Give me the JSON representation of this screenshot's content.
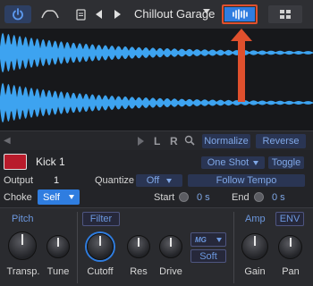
{
  "toolbar": {
    "preset_name": "Chillout Garage",
    "icons": [
      "power-icon",
      "envelope-icon",
      "preset-file-icon",
      "prev-arrow-icon",
      "next-arrow-icon",
      "waveform-view-icon",
      "pad-grid-icon"
    ]
  },
  "colors": {
    "accent": "#2f7de0",
    "highlight": "#e0502d",
    "pad": "#b81b2b",
    "waveform": "#3da3f0"
  },
  "wave_tools": {
    "left": "L",
    "right": "R",
    "normalize": "Normalize",
    "reverse": "Reverse"
  },
  "pad": {
    "name": "Kick 1",
    "mode": "One Shot",
    "toggle": "Toggle",
    "output_label": "Output",
    "output_value": "1",
    "quantize_label": "Quantize",
    "quantize_value": "Off",
    "follow_tempo": "Follow Tempo",
    "choke_label": "Choke",
    "choke_value": "Self",
    "start_label": "Start",
    "start_value": "0 s",
    "end_label": "End",
    "end_value": "0 s"
  },
  "sections": {
    "pitch": {
      "title": "Pitch",
      "knobs": [
        "Transp.",
        "Tune"
      ]
    },
    "filter": {
      "title": "Filter",
      "knobs": [
        "Cutoff",
        "Res",
        "Drive"
      ],
      "type": "MG",
      "mode": "Soft"
    },
    "amp": {
      "title": "Amp",
      "env": "ENV",
      "knobs": [
        "Gain",
        "Pan"
      ]
    }
  }
}
